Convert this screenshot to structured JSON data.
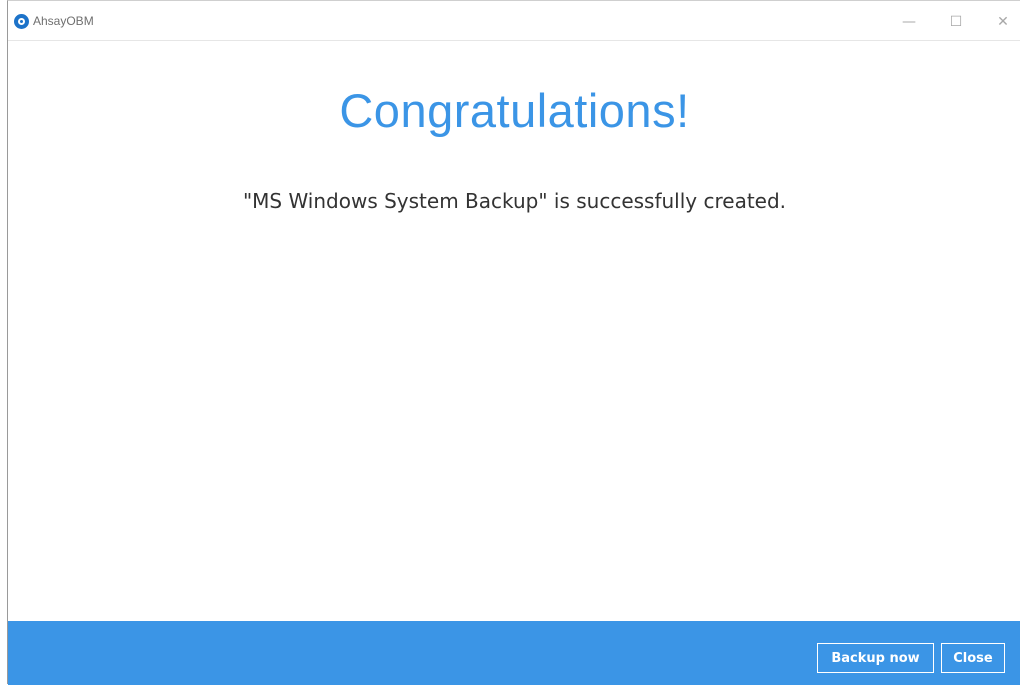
{
  "window": {
    "title": "AhsayOBM",
    "controls": {
      "minimize": "—",
      "maximize": "☐",
      "close": "✕"
    }
  },
  "main": {
    "headline": "Congratulations!",
    "message": "\"MS Windows System Backup\" is successfully created."
  },
  "footer": {
    "backup_now_label": "Backup now",
    "close_label": "Close"
  },
  "colors": {
    "accent": "#3b95e6",
    "logo": "#1d73c9"
  }
}
